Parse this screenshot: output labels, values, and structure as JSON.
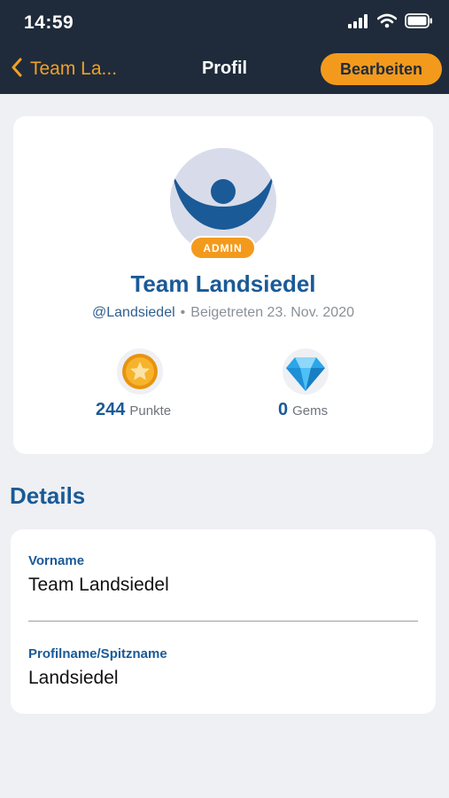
{
  "status_bar": {
    "time": "14:59",
    "icons": [
      "signal-icon",
      "wifi-icon",
      "battery-icon"
    ]
  },
  "nav": {
    "back_label": "Team La...",
    "title": "Profil",
    "edit_label": "Bearbeiten"
  },
  "profile": {
    "badge": "ADMIN",
    "name": "Team Landsiedel",
    "handle": "@Landsiedel",
    "separator": "•",
    "joined": "Beigetreten 23. Nov. 2020",
    "points_value": "244",
    "points_label": "Punkte",
    "gems_value": "0",
    "gems_label": "Gems"
  },
  "details": {
    "title": "Details",
    "fields": [
      {
        "label": "Vorname",
        "value": "Team Landsiedel"
      },
      {
        "label": "Profilname/Spitzname",
        "value": "Landsiedel"
      }
    ]
  },
  "colors": {
    "header_bg": "#1f2b3b",
    "accent": "#f39a1c",
    "brand_blue": "#1a5a97",
    "page_bg": "#eef0f4"
  }
}
